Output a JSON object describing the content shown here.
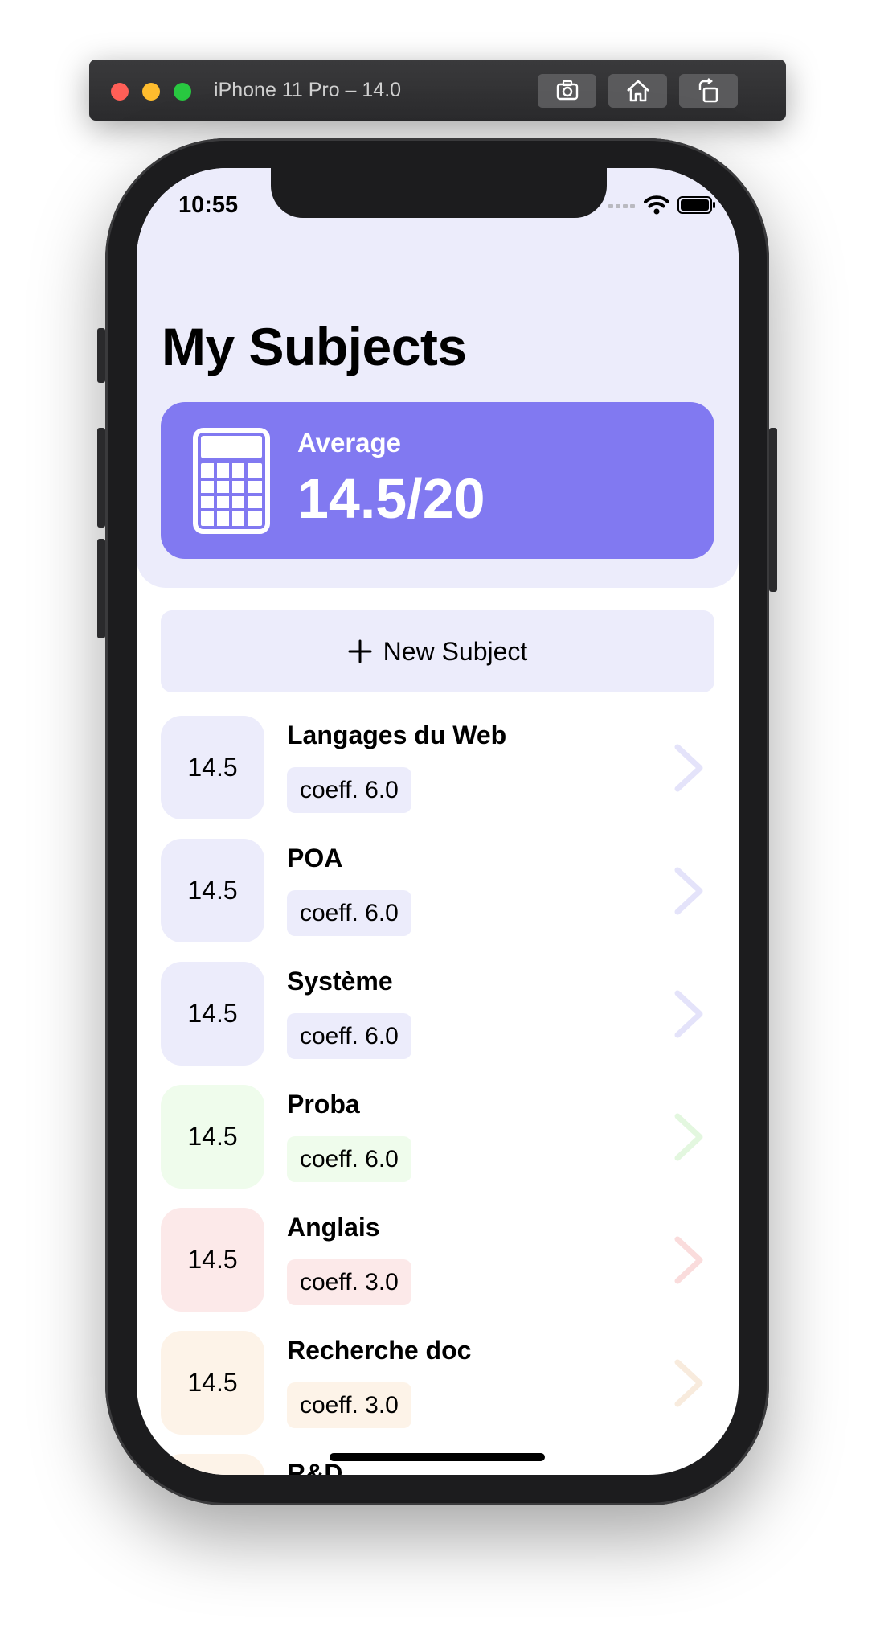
{
  "simulator": {
    "title": "iPhone 11 Pro – 14.0",
    "buttons": [
      "screenshot-icon",
      "home-icon",
      "rotate-icon"
    ]
  },
  "status_bar": {
    "time": "10:55"
  },
  "page": {
    "title": "My Subjects"
  },
  "average": {
    "label": "Average",
    "value": "14.5/20",
    "icon": "calculator-icon",
    "color": "#8179f1"
  },
  "new_subject": {
    "label": "New Subject",
    "icon": "plus-icon"
  },
  "subjects": [
    {
      "name": "Langages du Web",
      "grade": "14.5",
      "coeff": "coeff. 6.0",
      "tint": "#ececfb",
      "chevron": "#e4e3fa"
    },
    {
      "name": "POA",
      "grade": "14.5",
      "coeff": "coeff. 6.0",
      "tint": "#ececfb",
      "chevron": "#e4e3fa"
    },
    {
      "name": "Système",
      "grade": "14.5",
      "coeff": "coeff. 6.0",
      "tint": "#ececfb",
      "chevron": "#e4e3fa"
    },
    {
      "name": "Proba",
      "grade": "14.5",
      "coeff": "coeff. 6.0",
      "tint": "#effcec",
      "chevron": "#e3f7df"
    },
    {
      "name": "Anglais",
      "grade": "14.5",
      "coeff": "coeff. 3.0",
      "tint": "#fce9e9",
      "chevron": "#fadcdc"
    },
    {
      "name": "Recherche doc",
      "grade": "14.5",
      "coeff": "coeff. 3.0",
      "tint": "#fdf3e8",
      "chevron": "#f8ebdd"
    },
    {
      "name": "R&D",
      "grade": "",
      "coeff": "",
      "tint": "#fdf3e8",
      "chevron": "#f8ebdd"
    }
  ]
}
